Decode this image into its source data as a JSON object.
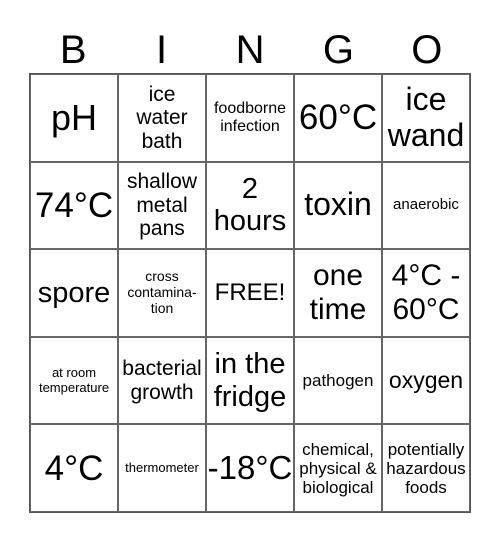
{
  "header": [
    "B",
    "I",
    "N",
    "G",
    "O"
  ],
  "cells": [
    [
      "pH",
      "ice water bath",
      "foodborne infection",
      "60°C",
      "ice wand"
    ],
    [
      "74°C",
      "shallow metal pans",
      "2 hours",
      "toxin",
      "anaerobic"
    ],
    [
      "spore",
      "cross contamina-tion",
      "FREE!",
      "one time",
      "4°C - 60°C"
    ],
    [
      "at room temperature",
      "bacterial growth",
      "in the fridge",
      "pathogen",
      "oxygen"
    ],
    [
      "4°C",
      "thermometer",
      "-18°C",
      "chemical, physical & biological",
      "potentially hazardous foods"
    ]
  ]
}
